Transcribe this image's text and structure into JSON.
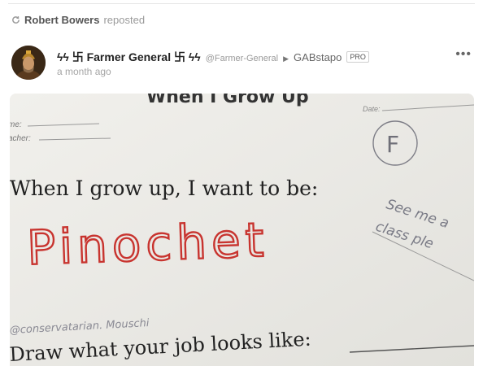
{
  "repost": {
    "icon": "repost-icon",
    "user": "Robert Bowers",
    "action": "reposted"
  },
  "post": {
    "avatar_icon": "avatar-portrait",
    "display_name": "ϟϟ 卐 Farmer General 卐 ϟϟ",
    "handle": "@Farmer-General",
    "arrow": "▶",
    "group": "GABstapo",
    "badge": "PRO",
    "timestamp": "a month ago",
    "menu": "•••"
  },
  "worksheet": {
    "header_partial": "When I Grow Up",
    "name_label": "me:",
    "teacher_label": "acher:",
    "date_label": "Date:",
    "grade": "F",
    "prompt": "When I grow up, I want to be:",
    "answer": "Pinochet",
    "teacher_note_line1": "See me a",
    "teacher_note_line2": "class ple",
    "watermark": "@conservatarian. Mouschi",
    "draw_prompt": "Draw what your job looks like:"
  },
  "colors": {
    "paper": "#ecebe7",
    "red_pen": "#c8342f",
    "muted_text": "#9a9a9a"
  }
}
